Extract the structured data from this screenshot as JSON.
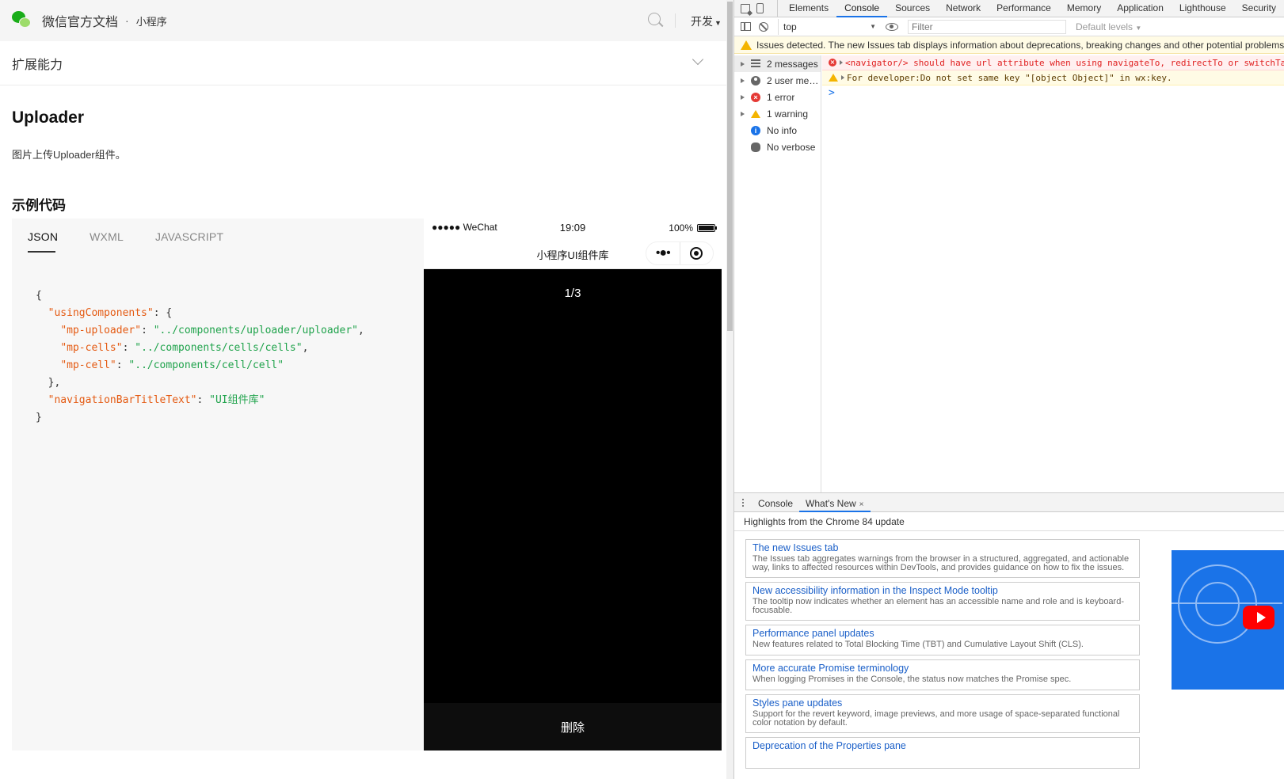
{
  "docs": {
    "site_title": "微信官方文档",
    "separator": "·",
    "sub_title": "小程序",
    "dev_menu": "开发",
    "section_title": "扩展能力",
    "heading": "Uploader",
    "description": "图片上传Uploader组件。",
    "example_heading": "示例代码",
    "code_tabs": [
      "JSON",
      "WXML",
      "JAVASCRIPT"
    ],
    "code": {
      "open": "{",
      "uc_key": "\"usingComponents\"",
      "uc_open": ": {",
      "l1_key": "\"mp-uploader\"",
      "l1_val": "\"../components/uploader/uploader\"",
      "l2_key": "\"mp-cells\"",
      "l2_val": "\"../components/cells/cells\"",
      "l3_key": "\"mp-cell\"",
      "l3_val": "\"../components/cell/cell\"",
      "uc_close": "},",
      "nb_key": "\"navigationBarTitleText\"",
      "nb_val": "\"UI组件库\"",
      "close": "}"
    }
  },
  "phone": {
    "carrier": "●●●●● WeChat",
    "time": "19:09",
    "battery": "100%",
    "nav_title": "小程序UI组件库",
    "more": "•●•",
    "gallery_index": "1/3",
    "delete_label": "删除"
  },
  "devtools": {
    "tabs": [
      "Elements",
      "Console",
      "Sources",
      "Network",
      "Performance",
      "Memory",
      "Application",
      "Lighthouse",
      "Security"
    ],
    "active_tab": "Console",
    "context": "top",
    "filter_placeholder": "Filter",
    "levels": "Default levels",
    "issues_banner": "Issues detected. The new Issues tab displays information about deprecations, breaking changes and other potential problems.",
    "sidebar": [
      {
        "label": "2 messages",
        "icon": "list-icon"
      },
      {
        "label": "2 user mes...",
        "icon": "user-icon"
      },
      {
        "label": "1 error",
        "icon": "error-icon"
      },
      {
        "label": "1 warning",
        "icon": "warning-icon"
      },
      {
        "label": "No info",
        "icon": "info-icon"
      },
      {
        "label": "No verbose",
        "icon": "bug-icon"
      }
    ],
    "messages": [
      {
        "level": "error",
        "text": "<navigator/> should have url attribute when using navigateTo, redirectTo or switchTab"
      },
      {
        "level": "warning",
        "text": "For developer:Do not set same key \"[object Object]\" in wx:key."
      }
    ],
    "prompt": ">",
    "drawer": {
      "tabs": [
        "Console",
        "What's New"
      ],
      "close": "×",
      "highlights": "Highlights from the Chrome 84 update",
      "items": [
        {
          "title": "The new Issues tab",
          "text": "The Issues tab aggregates warnings from the browser in a structured, aggregated, and actionable way, links to affected resources within DevTools, and provides guidance on how to fix the issues."
        },
        {
          "title": "New accessibility information in the Inspect Mode tooltip",
          "text": "The tooltip now indicates whether an element has an accessible name and role and is keyboard-focusable."
        },
        {
          "title": "Performance panel updates",
          "text": "New features related to Total Blocking Time (TBT) and Cumulative Layout Shift (CLS)."
        },
        {
          "title": "More accurate Promise terminology",
          "text": "When logging Promises in the Console, the status now matches the Promise spec."
        },
        {
          "title": "Styles pane updates",
          "text": "Support for the revert keyword, image previews, and more usage of space-separated functional color notation by default."
        },
        {
          "title": "Deprecation of the Properties pane",
          "text": ""
        }
      ]
    }
  }
}
